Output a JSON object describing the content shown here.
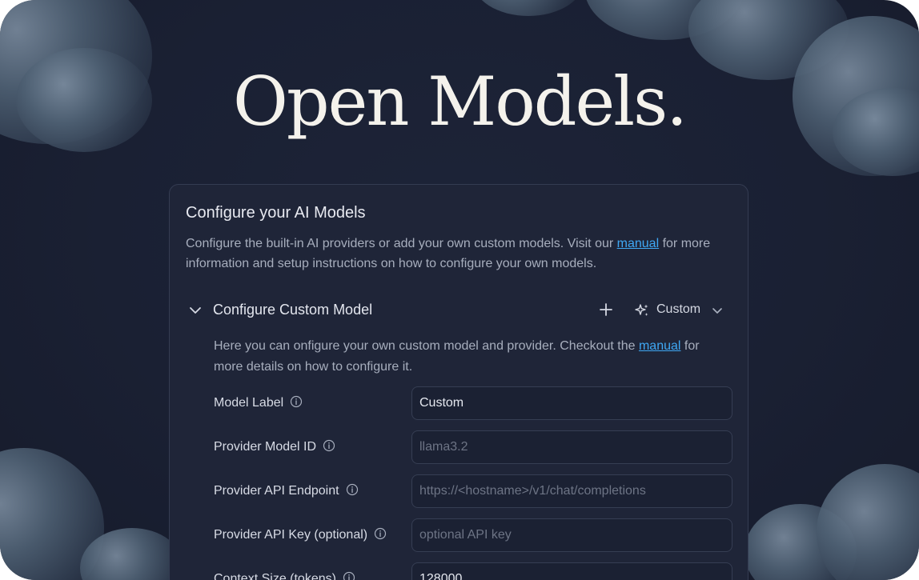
{
  "hero": {
    "title": "Open Models."
  },
  "card": {
    "title": "Configure your AI Models",
    "description_pre": "Configure the built-in AI providers or add your own custom models. Visit our ",
    "description_link": "manual",
    "description_post": " for more information and setup instructions on how to configure your own models."
  },
  "section": {
    "title": "Configure Custom Model",
    "plus_icon": "plus-icon",
    "model_select": {
      "icon": "sparkles-icon",
      "value": "Custom"
    },
    "description_pre": "Here you can onfigure your own custom model and provider. Checkout the ",
    "description_link": "manual",
    "description_post": " for more details on how to configure it."
  },
  "form": {
    "fields": [
      {
        "label": "Model Label",
        "value": "Custom",
        "placeholder": ""
      },
      {
        "label": "Provider Model ID",
        "value": "",
        "placeholder": "llama3.2"
      },
      {
        "label": "Provider API Endpoint",
        "value": "",
        "placeholder": "https://<hostname>/v1/chat/completions"
      },
      {
        "label": "Provider API Key (optional)",
        "value": "",
        "placeholder": "optional API key"
      },
      {
        "label": "Context Size (tokens)",
        "value": "128000",
        "placeholder": ""
      }
    ]
  },
  "colors": {
    "background": "#1a2033",
    "card": "#1f2538",
    "link": "#3fa8f4",
    "title": "#f4f2ec"
  }
}
